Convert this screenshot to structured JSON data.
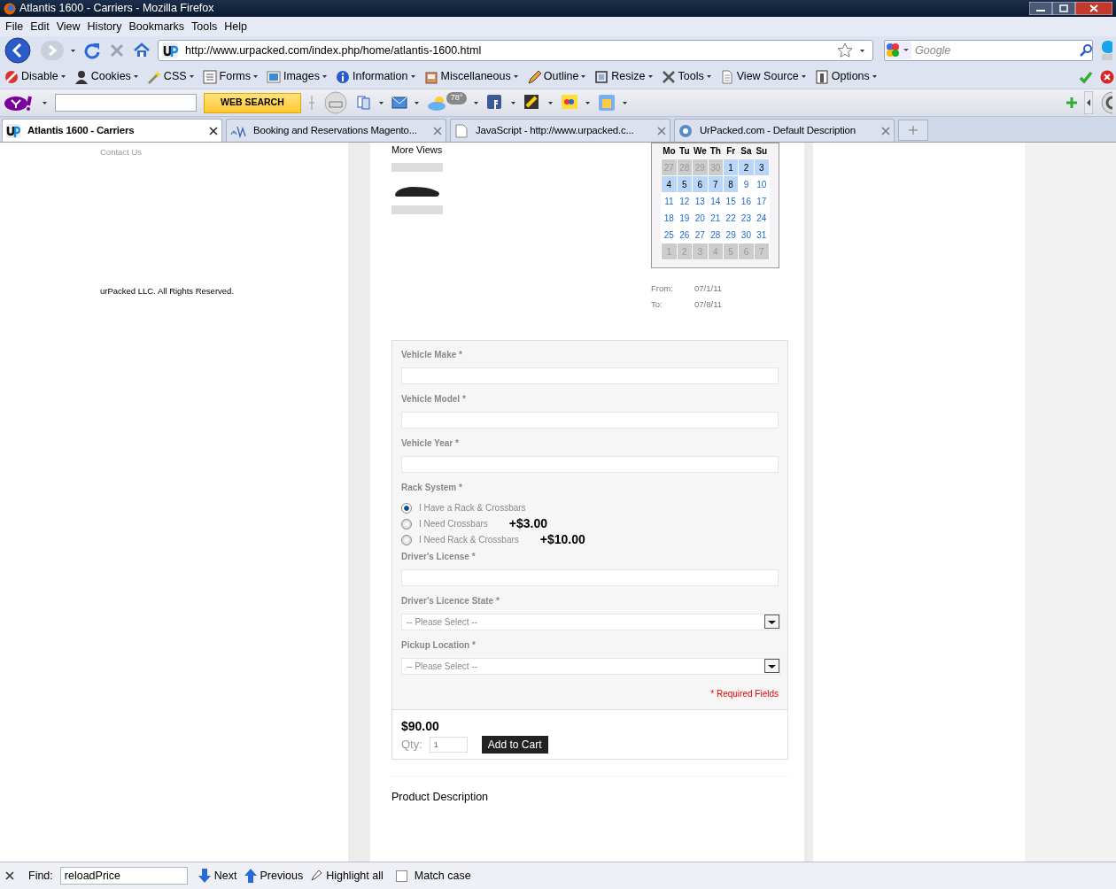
{
  "window": {
    "title": "Atlantis 1600 - Carriers - Mozilla Firefox"
  },
  "menu": [
    "File",
    "Edit",
    "View",
    "History",
    "Bookmarks",
    "Tools",
    "Help"
  ],
  "address_bar": {
    "url": "http://www.urpacked.com/index.php/home/atlantis-1600.html"
  },
  "search_box": {
    "placeholder": "Google"
  },
  "developer_toolbar": [
    "Disable",
    "Cookies",
    "CSS",
    "Forms",
    "Images",
    "Information",
    "Miscellaneous",
    "Outline",
    "Resize",
    "Tools",
    "View Source",
    "Options"
  ],
  "yahoo_toolbar": {
    "button": "WEB SEARCH",
    "weather": "78°"
  },
  "tabs": [
    {
      "title": "Atlantis 1600 - Carriers",
      "selected": true
    },
    {
      "title": "Booking and Reservations Magento...",
      "selected": false
    },
    {
      "title": "JavaScript - http://www.urpacked.c...",
      "selected": false
    },
    {
      "title": "UrPacked.com - Default Description",
      "selected": false
    }
  ],
  "sidebar": {
    "link": "Contact Us",
    "copyright": "urPacked LLC. All Rights Reserved."
  },
  "product": {
    "section_title": "More Views",
    "calendar": {
      "weekdays": [
        "Mo",
        "Tu",
        "We",
        "Th",
        "Fr",
        "Sa",
        "Su"
      ],
      "weeks": [
        [
          {
            "day": "27",
            "kind": "other",
            "selected": false
          },
          {
            "day": "28",
            "kind": "other",
            "selected": false
          },
          {
            "day": "29",
            "kind": "other",
            "selected": false
          },
          {
            "day": "30",
            "kind": "other",
            "selected": false
          },
          {
            "day": "1",
            "kind": "day",
            "selected": true
          },
          {
            "day": "2",
            "kind": "day",
            "selected": true
          },
          {
            "day": "3",
            "kind": "day",
            "selected": true
          }
        ],
        [
          {
            "day": "4",
            "kind": "day",
            "selected": true
          },
          {
            "day": "5",
            "kind": "day",
            "selected": true
          },
          {
            "day": "6",
            "kind": "day",
            "selected": true
          },
          {
            "day": "7",
            "kind": "day",
            "selected": true
          },
          {
            "day": "8",
            "kind": "day",
            "selected": true
          },
          {
            "day": "9",
            "kind": "day",
            "selected": false
          },
          {
            "day": "10",
            "kind": "day",
            "selected": false
          }
        ],
        [
          {
            "day": "11",
            "kind": "day",
            "selected": false
          },
          {
            "day": "12",
            "kind": "day",
            "selected": false
          },
          {
            "day": "13",
            "kind": "day",
            "selected": false
          },
          {
            "day": "14",
            "kind": "day",
            "selected": false
          },
          {
            "day": "15",
            "kind": "day",
            "selected": false
          },
          {
            "day": "16",
            "kind": "day",
            "selected": false
          },
          {
            "day": "17",
            "kind": "day",
            "selected": false
          }
        ],
        [
          {
            "day": "18",
            "kind": "day",
            "selected": false
          },
          {
            "day": "19",
            "kind": "day",
            "selected": false
          },
          {
            "day": "20",
            "kind": "day",
            "selected": false
          },
          {
            "day": "21",
            "kind": "day",
            "selected": false
          },
          {
            "day": "22",
            "kind": "day",
            "selected": false
          },
          {
            "day": "23",
            "kind": "day",
            "selected": false
          },
          {
            "day": "24",
            "kind": "day",
            "selected": false
          }
        ],
        [
          {
            "day": "25",
            "kind": "day",
            "selected": false
          },
          {
            "day": "26",
            "kind": "day",
            "selected": false
          },
          {
            "day": "27",
            "kind": "day",
            "selected": false
          },
          {
            "day": "28",
            "kind": "day",
            "selected": false
          },
          {
            "day": "29",
            "kind": "day",
            "selected": false
          },
          {
            "day": "30",
            "kind": "day",
            "selected": false
          },
          {
            "day": "31",
            "kind": "day",
            "selected": false
          }
        ],
        [
          {
            "day": "1",
            "kind": "other",
            "selected": false
          },
          {
            "day": "2",
            "kind": "other",
            "selected": false
          },
          {
            "day": "3",
            "kind": "other",
            "selected": false
          },
          {
            "day": "4",
            "kind": "other",
            "selected": false
          },
          {
            "day": "5",
            "kind": "other",
            "selected": false
          },
          {
            "day": "6",
            "kind": "other",
            "selected": false
          },
          {
            "day": "7",
            "kind": "other",
            "selected": false
          }
        ]
      ]
    },
    "dates": [
      {
        "label": "From:",
        "value": "07/1/11"
      },
      {
        "label": "To:",
        "value": "07/8/11"
      }
    ]
  },
  "form": {
    "fields": [
      {
        "kind": "text",
        "label": "Vehicle Make *"
      },
      {
        "kind": "text",
        "label": "Vehicle Model *"
      },
      {
        "kind": "text",
        "label": "Vehicle Year *"
      },
      {
        "kind": "radio",
        "label": "Rack System *",
        "options": [
          {
            "label": "I Have a Rack & Crossbars",
            "selected": true
          },
          {
            "label": "I Need Crossbars",
            "price": "+$3.00",
            "selected": false
          },
          {
            "label": "I Need Rack & Crossbars",
            "price": "+$10.00",
            "selected": false
          }
        ]
      },
      {
        "kind": "text",
        "label": "Driver's License *"
      },
      {
        "kind": "select",
        "label": "Driver's Licence State *",
        "placeholder": "-- Please Select --"
      },
      {
        "kind": "select",
        "label": "Pickup Location *",
        "placeholder": "-- Please Select --"
      }
    ],
    "required_note": "* Required Fields"
  },
  "cart": {
    "price": "$90.00",
    "qty_label": "Qty:",
    "qty": "1",
    "button": "Add to Cart"
  },
  "description_title": "Product Description",
  "find_bar": {
    "label": "Find:",
    "value": "reloadPrice",
    "next": "Next",
    "previous": "Previous",
    "highlight": "Highlight all",
    "match_case": {
      "label": "Match case",
      "checked": false
    }
  }
}
